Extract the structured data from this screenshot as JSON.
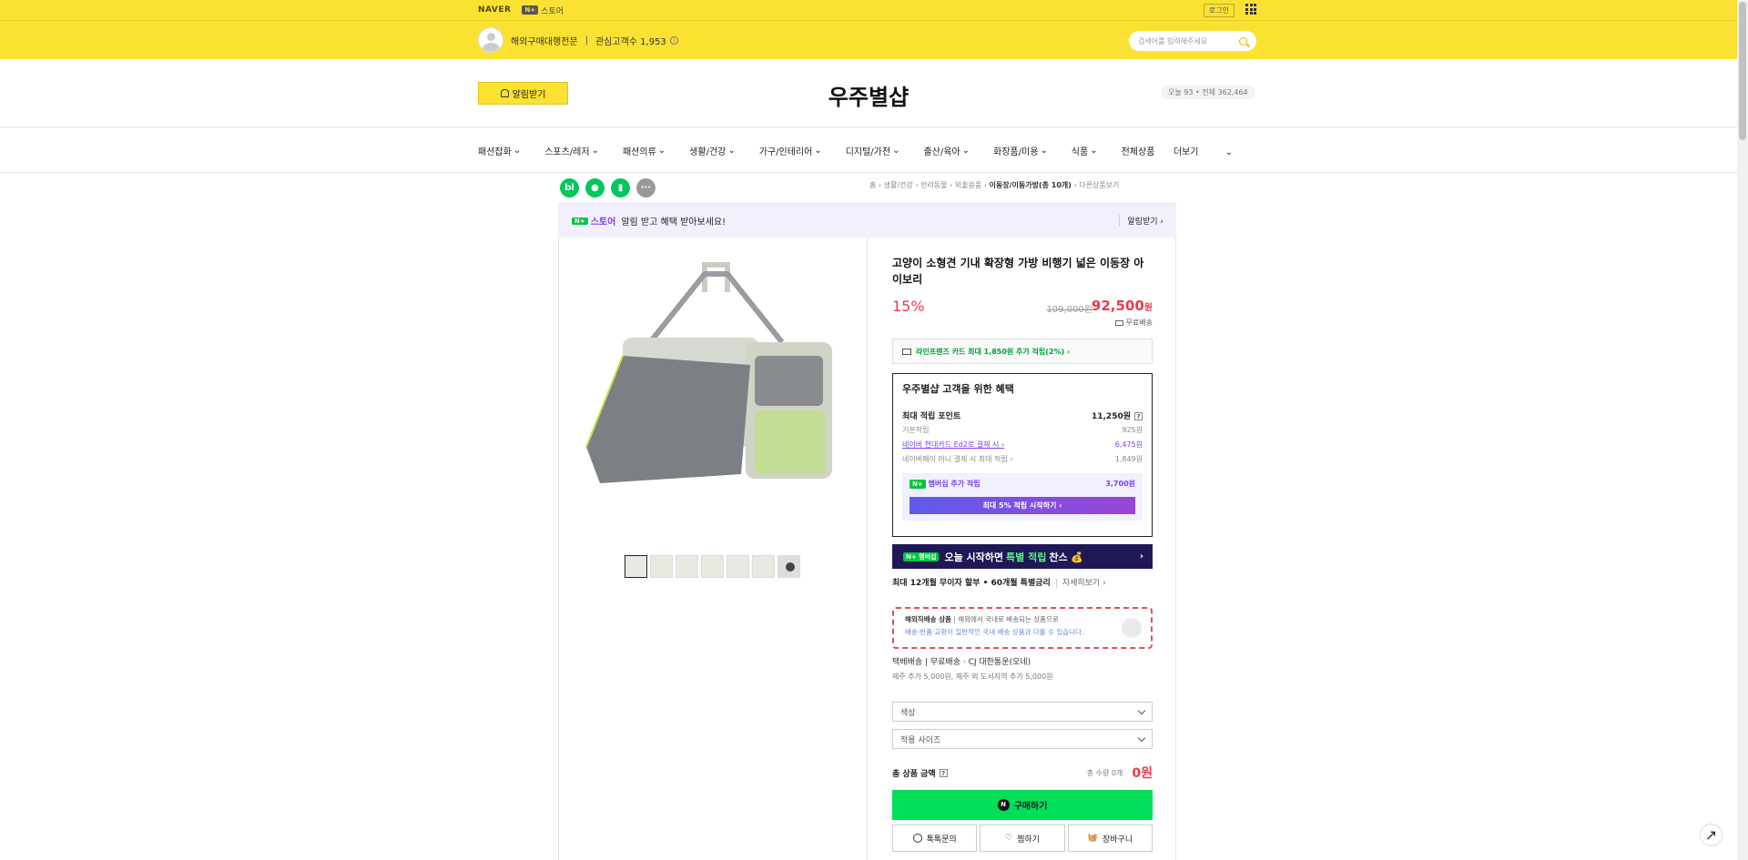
{
  "top": {
    "naver": "NAVER",
    "store_badge": "N+",
    "store": "스토어",
    "login": "로그인"
  },
  "storebar": {
    "name": "해외구매대행전문",
    "interest": "관심고객수 1,953"
  },
  "search": {
    "placeholder": "검색어를 입력해주세요"
  },
  "header": {
    "alarm": "알림받기",
    "logo": "우주별샵",
    "visit": "오늘 93 • 전체 362,464"
  },
  "gnb": {
    "items": [
      "패션잡화",
      "스포츠/레저",
      "패션의류",
      "생활/건강",
      "가구/인테리어",
      "디지털/가전",
      "출산/육아",
      "화장품/미용",
      "식품",
      "전체상품"
    ],
    "more": "더보기"
  },
  "social": [
    "bl",
    "",
    "",
    ""
  ],
  "breadcrumb": {
    "path": "홈 › 생활/건강 › 반려동물 › 외출용품 › ",
    "current": "이동장/이동가방(총 10개)",
    "tail": " › 다른상품보기"
  },
  "promo": {
    "badge": "N+",
    "brand": "스토어",
    "text": "알림 받고 혜택 받아보세요!",
    "link": "알림받기 ›"
  },
  "product": {
    "title": "고양이 소형견 기내 확장형 가방 비행기 넓은 이동장 아이보리",
    "discount": "15%",
    "original": "109,000원",
    "price": "92,500",
    "won": "원",
    "shipping": "무료배송",
    "card": "라인프렌즈 카드 최대 1,850원 추가 적립(2%) ›"
  },
  "benefit": {
    "title": "우주별샵 고객을 위한 혜택",
    "rows": [
      {
        "label": "최대 적립 포인트",
        "value": "11,250원"
      },
      {
        "label": "기본적립",
        "value": "925원"
      },
      {
        "label": "네이버 현대카드 Ed2로 결제 시 ›",
        "value": "6,475원"
      },
      {
        "label": "네이버페이 머니 결제 시 최대 적립 ›",
        "value": "1,849원"
      }
    ],
    "membership": {
      "badge": "N+",
      "label": "멤버십 추가 적립",
      "value": "3,700원",
      "button": "최대 5% 적립 시작하기 ›"
    }
  },
  "banner": {
    "badge": "N+ 멤버십",
    "t1": "오늘 시작하면",
    "t2": "특별 적립",
    "t3": "찬스 💰",
    "arrow": "›"
  },
  "installment": {
    "text": "최대 12개월 무이자 할부 • 60개월 특별금리",
    "link": "자세히보기 ›"
  },
  "overseas": {
    "title": "해외직배송 상품",
    "sub": "해외에서 국내로 배송되는 상품으로",
    "note": "배송·반품·교환이 일반적인 국내 배송 상품과 다를 수 있습니다."
  },
  "delivery": {
    "line1": "택배배송 | 무료배송 · CJ 대한통운(오네)",
    "line2": "제주 추가 5,000원, 제주 외 도서지역 추가 5,000원"
  },
  "options": [
    "색상",
    "적용 사이즈"
  ],
  "total": {
    "label": "총 상품 금액",
    "count": "총 수량 0개",
    "amount": "0원"
  },
  "buttons": {
    "buy": "구매하기",
    "talk": "톡톡문의",
    "wish": "찜하기",
    "cart": "장바구니"
  },
  "colors": {
    "yellow": "#fbe132",
    "green": "#00de5a",
    "red": "#f0384a",
    "purple": "#7b3ff2"
  }
}
